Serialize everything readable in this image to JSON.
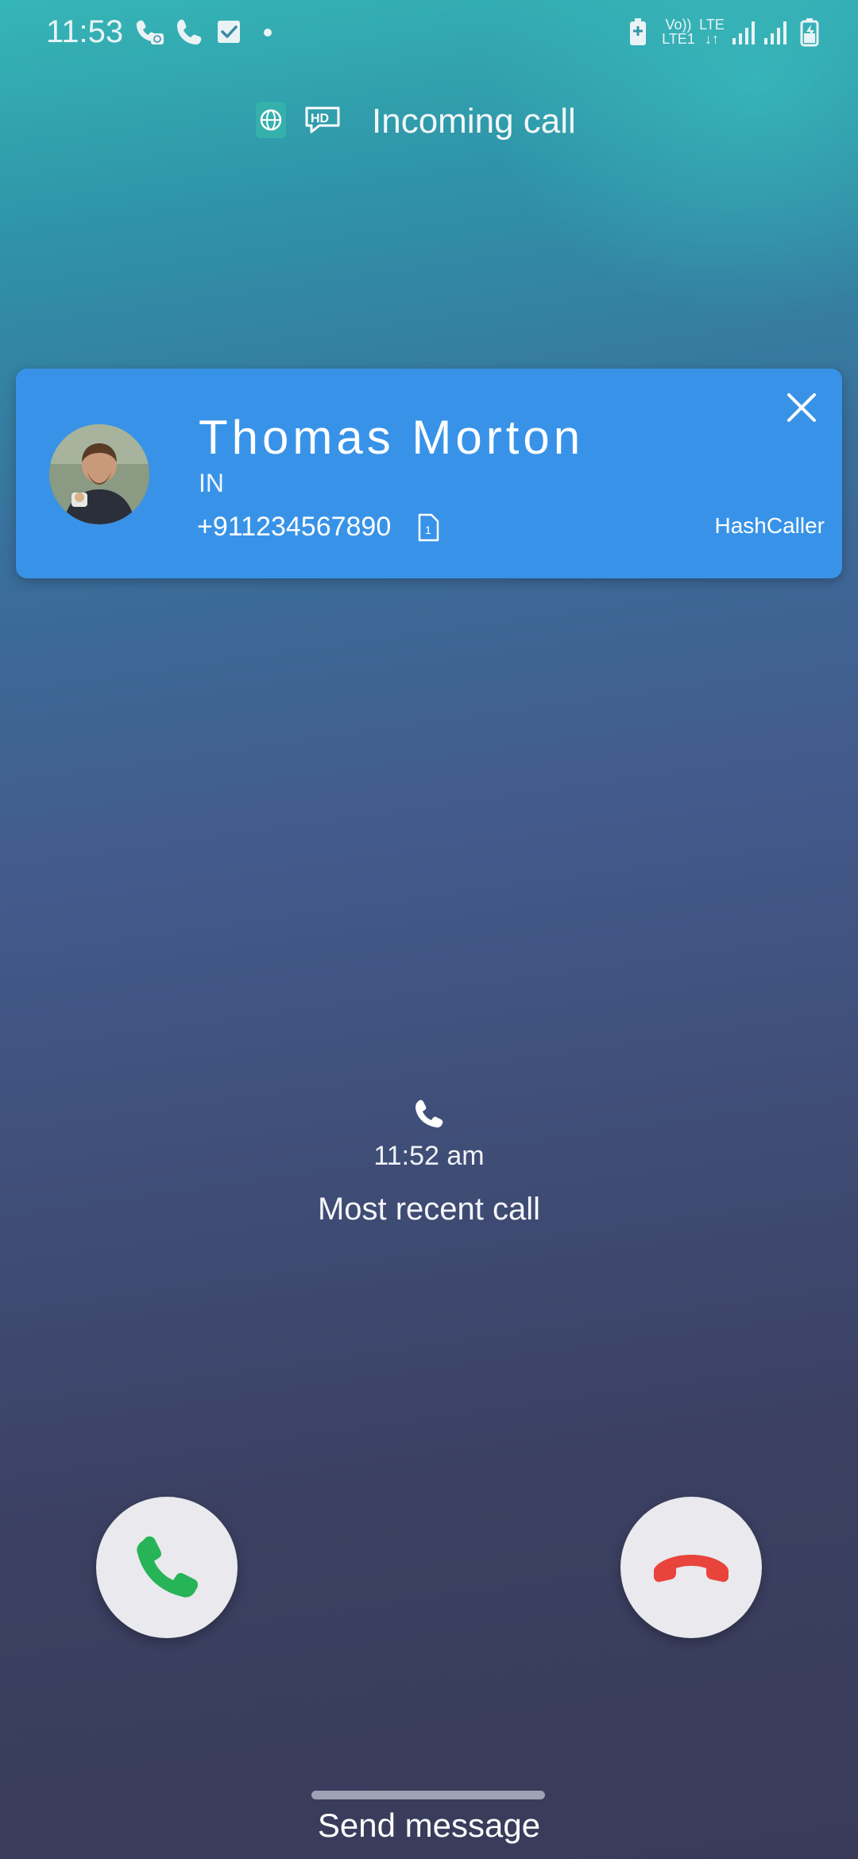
{
  "status_bar": {
    "time": "11:53",
    "volte_top": "Vo))",
    "volte_bottom": "LTE1",
    "lte_label": "LTE",
    "icons": [
      "wifi-calling-icon",
      "phone-icon",
      "checkbox-notification-icon",
      "dot-icon",
      "battery-saver-icon",
      "volte-icon",
      "lte-data-icon",
      "signal-sim1-icon",
      "signal-sim2-icon",
      "battery-charging-icon"
    ]
  },
  "header": {
    "title": "Incoming call",
    "badges": [
      "globe-icon",
      "hd-voice-icon"
    ]
  },
  "caller_card": {
    "name": "Thomas Morton",
    "country": "IN",
    "number": "+911234567890",
    "sim_slot": "1",
    "app_name": "HashCaller",
    "close_icon": "close-icon",
    "accent_color": "#3893e8"
  },
  "recent_call": {
    "icon": "phone-icon",
    "time": "11:52 am",
    "label": "Most recent call"
  },
  "actions": {
    "accept_icon": "phone-accept-icon",
    "accept_color": "#27b357",
    "decline_icon": "phone-decline-icon",
    "decline_color": "#e8443b"
  },
  "bottom": {
    "send_message": "Send message"
  }
}
